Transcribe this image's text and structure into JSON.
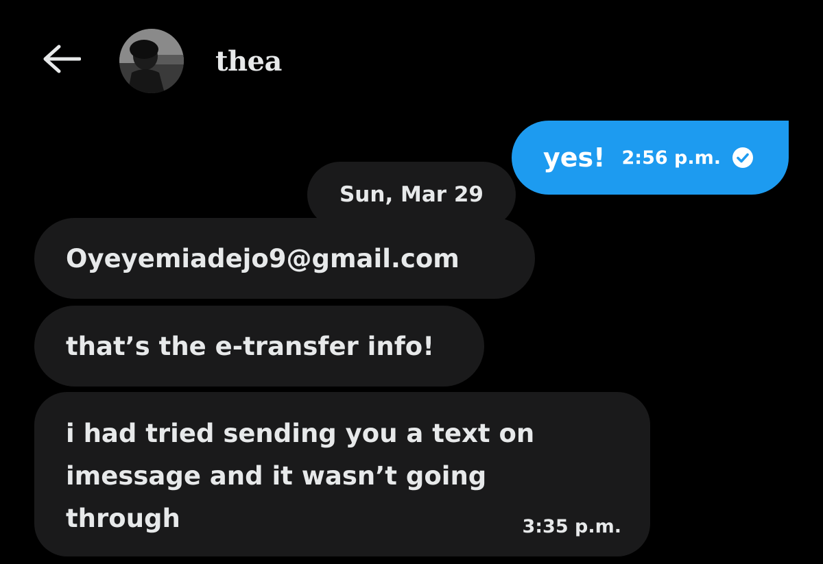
{
  "contact": {
    "name": "thea"
  },
  "icons": {
    "back": "arrow-left-icon",
    "avatar": "profile-photo",
    "read_receipt": "check-circle-icon"
  },
  "colors": {
    "background": "#000000",
    "sent_bubble": "#1d9bf0",
    "received_bubble": "#1a1a1b",
    "text": "#e7e9ea"
  },
  "messages": {
    "sent": {
      "text": "yes!",
      "time": "2:56 p.m."
    },
    "date_separator": "Sun, Mar 29",
    "received": [
      {
        "text": "Oyeyemiadejo9@gmail.com"
      },
      {
        "text": "that’s the e-transfer info!"
      },
      {
        "lines": [
          "i had tried sending you a text on",
          "imessage and it wasn’t going",
          "through"
        ],
        "time": "3:35 p.m."
      }
    ]
  }
}
